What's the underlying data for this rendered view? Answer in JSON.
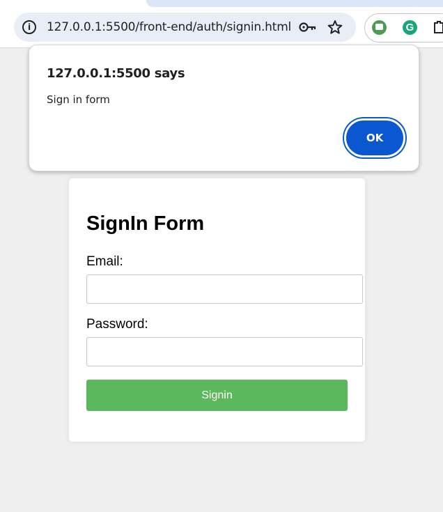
{
  "browser": {
    "url": "127.0.0.1:5500/front-end/auth/signin.html"
  },
  "dialog": {
    "title": "127.0.0.1:5500 says",
    "message": "Sign in form",
    "ok_label": "OK"
  },
  "form": {
    "title": "SignIn Form",
    "email_label": "Email:",
    "email_value": "",
    "password_label": "Password:",
    "password_value": "",
    "submit_label": "Signin"
  },
  "icons": {
    "site_info": "info-icon",
    "password_manager": "key-icon",
    "bookmark": "star-icon",
    "extension_1": "robot-extension-icon",
    "extension_2": "grammarly-icon",
    "extension_3": "puzzle-extension-icon"
  },
  "colors": {
    "submit_button": "#5cb85c",
    "ok_button": "#0b57d0",
    "page_background": "#efefef"
  }
}
